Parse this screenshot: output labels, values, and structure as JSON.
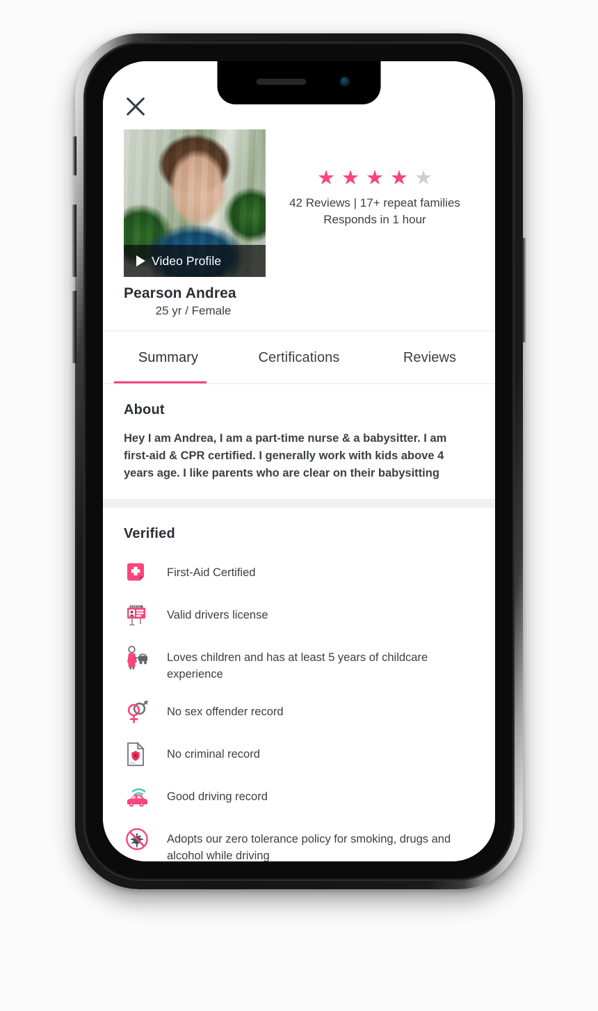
{
  "screen": {
    "close_icon": "close-icon",
    "video": {
      "play_icon": "play-icon",
      "label": "Video Profile"
    },
    "rating": {
      "filled": 4,
      "total": 5,
      "star_glyph": "★",
      "filled_color": "#f8457a",
      "empty_color": "#cfcfcf",
      "reviews_line": "42 Reviews | 17+ repeat families",
      "responds_line": "Responds in 1 hour"
    },
    "profile": {
      "name": "Pearson Andrea",
      "meta": "25 yr / Female"
    },
    "tabs": [
      {
        "label": "Summary",
        "active": true
      },
      {
        "label": "Certifications",
        "active": false
      },
      {
        "label": "Reviews",
        "active": false
      }
    ],
    "about": {
      "title": "About",
      "body": "Hey I am Andrea, I am a part-time nurse & a babysitter. I am first-aid & CPR certified. I generally work with kids above 4 years age. I like parents who are clear on their babysitting"
    },
    "verified": {
      "title": "Verified",
      "items": [
        {
          "icon": "first-aid-icon",
          "text": "First-Aid Certified"
        },
        {
          "icon": "drivers-license-icon",
          "text": "Valid drivers license"
        },
        {
          "icon": "childcare-nanny-icon",
          "text": "Loves children and has at least 5 years of childcare experience"
        },
        {
          "icon": "gender-symbols-icon",
          "text": "No sex offender record"
        },
        {
          "icon": "criminal-record-icon",
          "text": "No criminal record"
        },
        {
          "icon": "connected-car-icon",
          "text": "Good driving record"
        },
        {
          "icon": "no-smoking-icon",
          "text": "Adopts our zero tolerance policy for smoking, drugs and alcohol while driving"
        }
      ]
    }
  },
  "colors": {
    "accent_pink": "#f8457a",
    "text_dark": "#2b2f33",
    "text_body": "#3c4043",
    "divider": "#e4e5e7",
    "section_gap": "#f1f1f1",
    "teal": "#4ec9b8"
  }
}
